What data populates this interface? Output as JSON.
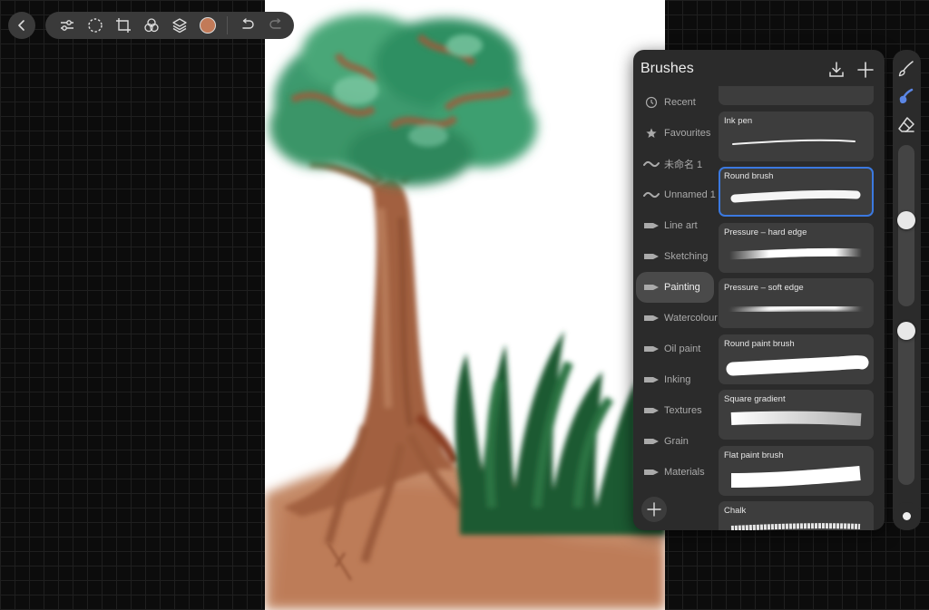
{
  "colors": {
    "current_color": "#c27a58",
    "selection_accent": "#3b79e0",
    "active_tool": "#5b86e5"
  },
  "toolbar": {
    "back_icon": "chevron-left-icon",
    "tools": [
      {
        "name": "adjustments",
        "icon": "sliders-icon"
      },
      {
        "name": "selection",
        "icon": "selection-icon"
      },
      {
        "name": "transform",
        "icon": "crop-icon"
      },
      {
        "name": "filters",
        "icon": "circles-icon"
      },
      {
        "name": "layers",
        "icon": "layers-icon"
      }
    ],
    "undo_icon": "undo-icon",
    "redo_icon": "redo-icon"
  },
  "brushes_panel": {
    "title": "Brushes",
    "import_icon": "download-icon",
    "add_icon": "plus-icon",
    "categories": [
      {
        "label": "Recent",
        "icon": "clock-icon"
      },
      {
        "label": "Favourites",
        "icon": "star-icon"
      },
      {
        "label": "未命名 1",
        "icon": "wave-icon"
      },
      {
        "label": "Unnamed 1",
        "icon": "wave-icon"
      },
      {
        "label": "Line art",
        "icon": "brush-tip-icon"
      },
      {
        "label": "Sketching",
        "icon": "brush-tip-icon"
      },
      {
        "label": "Painting",
        "icon": "brush-tip-icon",
        "active": true
      },
      {
        "label": "Watercolour",
        "icon": "brush-tip-icon"
      },
      {
        "label": "Oil paint",
        "icon": "brush-tip-icon"
      },
      {
        "label": "Inking",
        "icon": "brush-tip-icon"
      },
      {
        "label": "Textures",
        "icon": "brush-tip-icon"
      },
      {
        "label": "Grain",
        "icon": "brush-tip-icon"
      },
      {
        "label": "Materials",
        "icon": "brush-tip-icon"
      }
    ],
    "brushes": [
      {
        "name": ""
      },
      {
        "name": "Ink pen"
      },
      {
        "name": "Round brush",
        "selected": true
      },
      {
        "name": "Pressure – hard edge"
      },
      {
        "name": "Pressure – soft edge"
      },
      {
        "name": "Round paint brush"
      },
      {
        "name": "Square gradient"
      },
      {
        "name": "Flat paint brush"
      },
      {
        "name": "Chalk"
      }
    ]
  },
  "side_rail": {
    "tools": [
      {
        "name": "paint",
        "icon": "brush-icon"
      },
      {
        "name": "smudge",
        "icon": "smudge-icon",
        "active": true
      },
      {
        "name": "erase",
        "icon": "eraser-icon"
      }
    ],
    "size_level": 0.46,
    "opacity_level": 0.0,
    "modify_icon": "modify-dot-icon"
  }
}
